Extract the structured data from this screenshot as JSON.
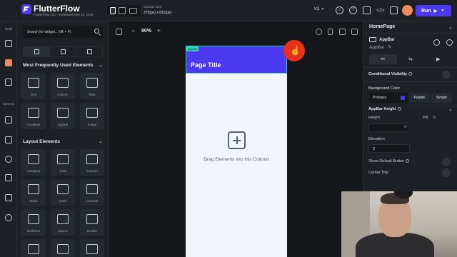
{
  "app": {
    "brand": "FlutterFlow",
    "version_text": "FlutterFlow v2.0 - Released May 22, 2022",
    "canvas_size_label": "Canvas Size",
    "canvas_size_value": "375(px) x 812(px)",
    "version_select": "v1",
    "run_label": "Run",
    "profile_initial": "",
    "accent_color": "#4b39ef"
  },
  "rail": {
    "build_label": "Build",
    "connect_label": "Connect"
  },
  "widgets": {
    "search_placeholder": "Search for widget... (⌘ + F)",
    "section_frequent": "Most Frequently Used Elements",
    "frequent": [
      {
        "label": "Text",
        "icon": "text-icon"
      },
      {
        "label": "Column",
        "icon": "column-icon"
      },
      {
        "label": "Row",
        "icon": "row-icon"
      },
      {
        "label": "Container",
        "icon": "container-icon"
      },
      {
        "label": "AppBar",
        "icon": "appbar-icon"
      },
      {
        "label": "Image",
        "icon": "image-icon"
      }
    ],
    "section_layout": "Layout Elements",
    "layout": [
      {
        "label": "Container",
        "icon": "container-icon"
      },
      {
        "label": "Row",
        "icon": "row-icon"
      },
      {
        "label": "Column",
        "icon": "column-icon"
      },
      {
        "label": "Stack",
        "icon": "stack-icon"
      },
      {
        "label": "Card",
        "icon": "card-icon"
      },
      {
        "label": "ListView",
        "icon": "listview-icon"
      },
      {
        "label": "GridView",
        "icon": "gridview-icon"
      },
      {
        "label": "Spacer",
        "icon": "spacer-icon"
      },
      {
        "label": "Divider",
        "icon": "divider-icon"
      }
    ]
  },
  "canvas": {
    "zoom": "90%",
    "appbar_tag": "AppBar",
    "page_title": "Page Title",
    "drag_hint": "Drag Elements into this Column"
  },
  "props": {
    "page_name": "HomePage",
    "widget_name": "AppBar",
    "widget_type": "AppBar",
    "conditional_visibility": "Conditional Visibility",
    "background_color_label": "Background Color",
    "background_color_value": "Primary",
    "palette_label": "Palette",
    "simple_label": "Simple",
    "appbar_height_label": "AppBar Height",
    "height_label": "Height",
    "unit_px": "PX",
    "unit_pct": "%",
    "height_value": "∞",
    "elevation_label": "Elevation",
    "elevation_value": "2",
    "show_default_button": "Show Default Button",
    "center_title": "Center Title"
  }
}
